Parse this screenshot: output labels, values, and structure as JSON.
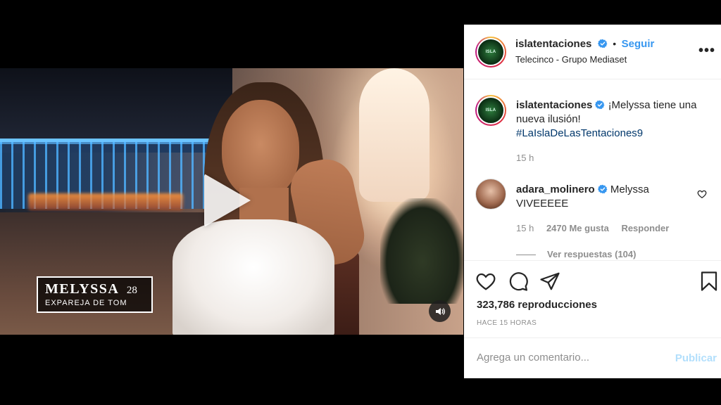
{
  "video": {
    "name_tag": {
      "name": "MELYSSA",
      "age": "28",
      "subtitle": "EXPAREJA DE TOM"
    }
  },
  "header": {
    "username": "islatentaciones",
    "separator": "•",
    "follow_label": "Seguir",
    "subtitle": "Telecinco - Grupo Mediaset",
    "more_label": "•••"
  },
  "caption": {
    "username": "islatentaciones",
    "text": "¡Melyssa tiene una nueva ilusión!",
    "hashtag": "#LaIslaDeLasTentaciones9",
    "time": "15 h"
  },
  "comment": {
    "username": "adara_molinero",
    "text": "Melyssa VIVEEEEE",
    "time": "15 h",
    "likes": "2470 Me gusta",
    "reply_label": "Responder",
    "view_replies": "Ver respuestas (104)"
  },
  "actions": {
    "views": "323,786 reproducciones",
    "ago": "HACE 15 HORAS"
  },
  "comment_box": {
    "placeholder": "Agrega un comentario...",
    "publish_label": "Publicar"
  },
  "colors": {
    "accent": "#3797f0",
    "hashtag": "#00376b",
    "muted": "#8e8e8e",
    "publish_disabled": "#b2dffc"
  }
}
